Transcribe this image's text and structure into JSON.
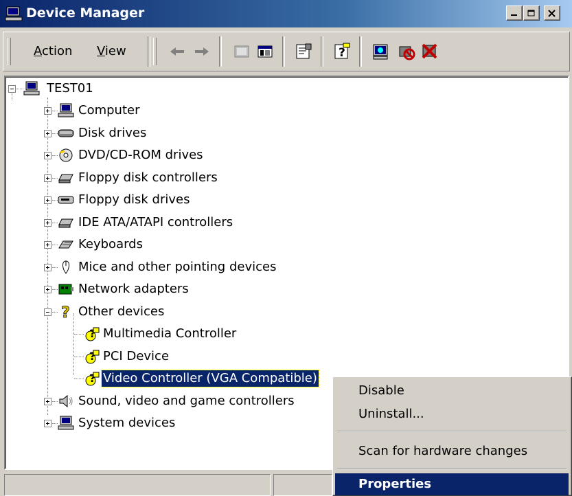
{
  "window": {
    "title": "Device Manager",
    "buttons": [
      "minimize",
      "maximize",
      "close"
    ]
  },
  "toolbar": {
    "menus": [
      {
        "label": "Action",
        "mnemonic": "A",
        "rest": "ction"
      },
      {
        "label": "View",
        "mnemonic": "V",
        "rest": "iew"
      }
    ],
    "buttons": [
      "back-icon",
      "forward-icon",
      "up-icon",
      "show-hide-tree-icon",
      "properties-icon",
      "help-icon",
      "scan-hardware-icon",
      "disable-device-icon",
      "uninstall-device-icon"
    ]
  },
  "tree": {
    "root": "TEST01",
    "items": [
      {
        "label": "Computer",
        "icon": "computer-icon",
        "expanded": false
      },
      {
        "label": "Disk drives",
        "icon": "disk-drive-icon",
        "expanded": false
      },
      {
        "label": "DVD/CD-ROM drives",
        "icon": "dvd-icon",
        "expanded": false
      },
      {
        "label": "Floppy disk controllers",
        "icon": "controller-icon",
        "expanded": false
      },
      {
        "label": "Floppy disk drives",
        "icon": "floppy-icon",
        "expanded": false
      },
      {
        "label": "IDE ATA/ATAPI controllers",
        "icon": "controller-icon",
        "expanded": false
      },
      {
        "label": "Keyboards",
        "icon": "keyboard-icon",
        "expanded": false
      },
      {
        "label": "Mice and other pointing devices",
        "icon": "mouse-icon",
        "expanded": false
      },
      {
        "label": "Network adapters",
        "icon": "network-icon",
        "expanded": false
      },
      {
        "label": "Other devices",
        "icon": "question-icon",
        "expanded": true,
        "children": [
          {
            "label": "Multimedia Controller",
            "icon": "unknown-device-icon"
          },
          {
            "label": "PCI Device",
            "icon": "unknown-device-icon"
          },
          {
            "label": "Video Controller (VGA Compatible)",
            "icon": "unknown-device-icon",
            "selected": true
          }
        ]
      },
      {
        "label": "Sound, video and game controllers",
        "icon": "speaker-icon",
        "expanded": false
      },
      {
        "label": "System devices",
        "icon": "computer-icon",
        "expanded": false
      }
    ]
  },
  "context_menu": {
    "items": [
      "Disable",
      "Uninstall...",
      "Scan for hardware changes",
      "Properties"
    ],
    "highlighted": "Properties"
  },
  "colors": {
    "title_gradient_start": "#0a246a",
    "selection": "#0a246a",
    "face": "#d4d0c8"
  }
}
